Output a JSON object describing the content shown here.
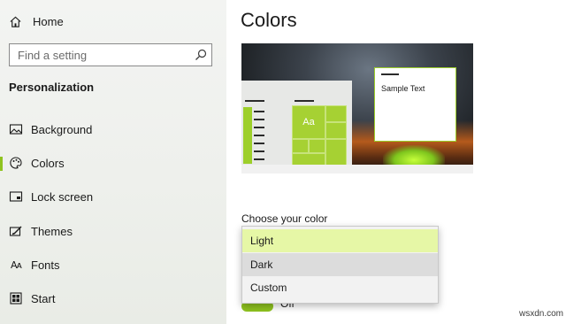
{
  "sidebar": {
    "home_label": "Home",
    "search_placeholder": "Find a setting",
    "section_title": "Personalization",
    "items": [
      {
        "label": "Background",
        "icon": "picture-icon"
      },
      {
        "label": "Colors",
        "icon": "palette-icon",
        "active": true
      },
      {
        "label": "Lock screen",
        "icon": "lock-screen-icon"
      },
      {
        "label": "Themes",
        "icon": "themes-icon"
      },
      {
        "label": "Fonts",
        "icon": "fonts-icon",
        "glyph": "Aᴀ"
      },
      {
        "label": "Start",
        "icon": "start-icon"
      }
    ]
  },
  "main": {
    "title": "Colors",
    "preview": {
      "sample_text": "Sample Text",
      "tile_label": "Aa"
    },
    "choose_label": "Choose your color",
    "toggle_partial_label": "Off",
    "dropdown": {
      "options": [
        "Light",
        "Dark",
        "Custom"
      ],
      "selected": "Light",
      "hovered": "Dark"
    }
  },
  "watermark": "wsxdn.com",
  "colors": {
    "accent": "#8fc31f",
    "selected_option_bg": "#e6f7a6",
    "hover_option_bg": "#dcdcdc"
  }
}
